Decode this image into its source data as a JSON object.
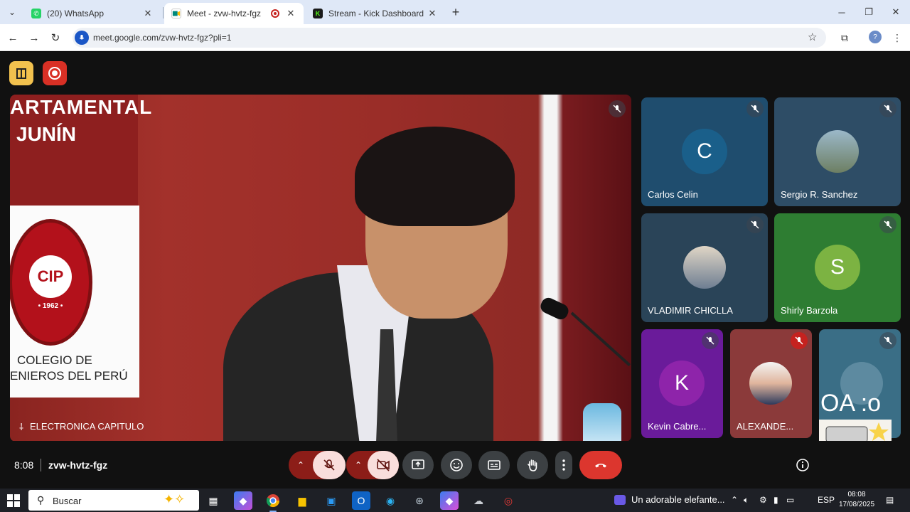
{
  "browser": {
    "tabs": [
      {
        "title": "(20) WhatsApp",
        "icon": "whatsapp-icon",
        "color": "#25d366"
      },
      {
        "title": "Meet - zvw-hvtz-fgz",
        "icon": "meet-icon",
        "color": "#00897b",
        "active": true
      },
      {
        "title": "Stream - Kick Dashboard",
        "icon": "kick-icon",
        "color": "#53fc18"
      }
    ],
    "url": "meet.google.com/zvw-hvtz-fgz?pli=1"
  },
  "meet": {
    "main_speaker": {
      "name": "ELECTRONICA CAPITULO",
      "banner_line1": "ARTAMENTAL",
      "banner_line2": "JUNÍN",
      "seal_letters": "CIP",
      "seal_year": "• 1962 •",
      "banner_line3": "COLEGIO DE",
      "banner_line4": "ENIEROS DEL PERÚ"
    },
    "participants": [
      {
        "name": "Carlos Celin",
        "initial": "C",
        "bg": "#1f4d6e",
        "avatar_color": "#1a5f8a"
      },
      {
        "name": "Sergio R. Sanchez",
        "bg": "#2e4d66"
      },
      {
        "name": "VLADIMIR CHICLLA",
        "bg": "#2a4458"
      },
      {
        "name": "Shirly Barzola",
        "initial": "S",
        "bg": "#2e7d32",
        "avatar_color": "#7cb342"
      },
      {
        "name": "Kevin Cabre...",
        "initial": "K",
        "bg": "#6a1b9a",
        "avatar_color": "#8e24aa"
      },
      {
        "name": "ALEXANDE...",
        "bg": "#8b3a3a"
      }
    ],
    "overlay_text": "OA :o",
    "clock": "8:08",
    "meeting_code": "zvw-hvtz-fgz"
  },
  "taskbar": {
    "search_placeholder": "Buscar",
    "media_title": "Un adorable elefante...",
    "lang": "ESP",
    "time": "08:08",
    "date": "17/08/2025"
  }
}
